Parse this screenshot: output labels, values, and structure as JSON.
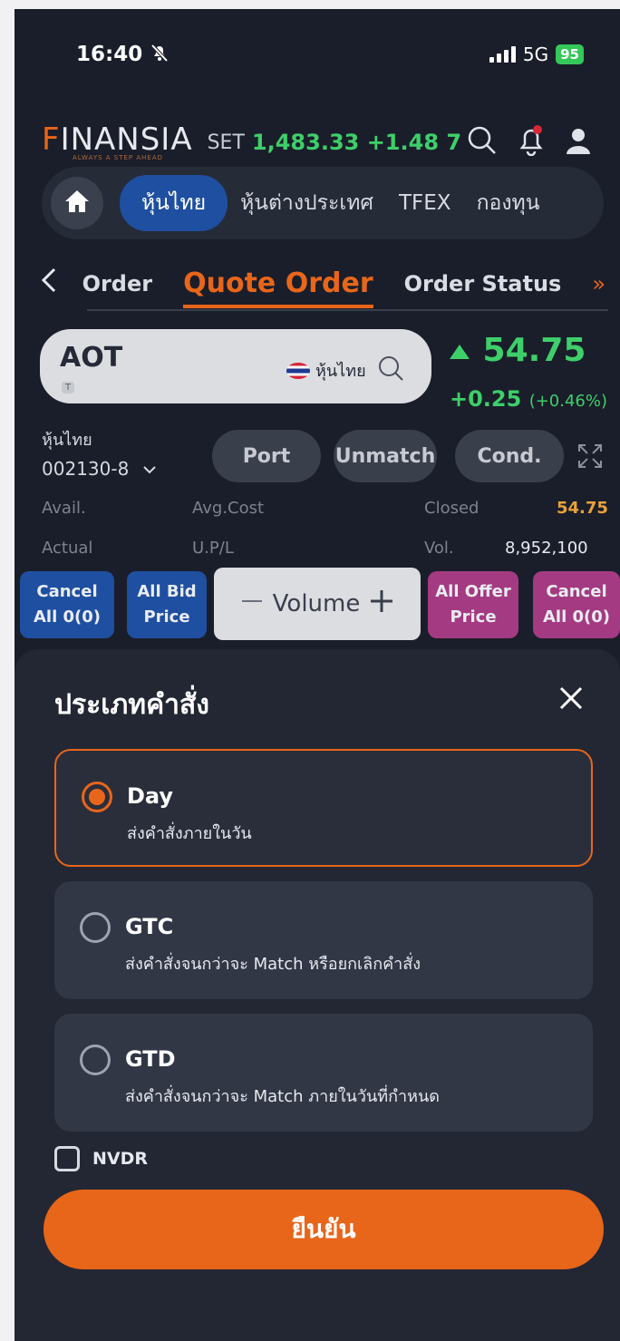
{
  "status_bar": {
    "time": "16:40",
    "network": "5G",
    "battery": "95"
  },
  "header": {
    "logo": "FINANSIA",
    "logo_tagline": "ALWAYS A STEP AHEAD",
    "index_label": "SET",
    "index_value": "1,483.33 +1.48 7",
    "icons": [
      "search-icon",
      "bell-icon",
      "user-icon"
    ]
  },
  "nav": {
    "tabs": [
      {
        "label": "หุ้นไทย",
        "active": true
      },
      {
        "label": "หุ้นต่างประเทศ",
        "active": false
      },
      {
        "label": "TFEX",
        "active": false
      },
      {
        "label": "กองทุน",
        "active": false
      }
    ]
  },
  "sub_tabs": {
    "items": [
      {
        "label": "Order",
        "active": false
      },
      {
        "label": "Quote Order",
        "active": true
      },
      {
        "label": "Order Status",
        "active": false
      }
    ],
    "more": "»"
  },
  "symbol": {
    "ticker": "AOT",
    "badge": "T",
    "market": "หุ้นไทย",
    "price": "54.75",
    "change": "+0.25",
    "change_pct": "(+0.46%)"
  },
  "account": {
    "type": "หุ้นไทย",
    "number": "002130-8",
    "buttons": [
      "Port",
      "Unmatch",
      "Cond."
    ]
  },
  "info": {
    "avail_label": "Avail.",
    "avg_cost_label": "Avg.Cost",
    "closed_label": "Closed",
    "closed_value": "54.75",
    "actual_label": "Actual",
    "upl_label": "U.P/L",
    "vol_label": "Vol.",
    "vol_value": "8,952,100"
  },
  "quote_actions": {
    "cancel_bid": [
      "Cancel",
      "All 0(0)"
    ],
    "all_bid": [
      "All Bid",
      "Price"
    ],
    "volume": "Volume",
    "all_offer": [
      "All Offer",
      "Price"
    ],
    "cancel_offer": [
      "Cancel",
      "All 0(0)"
    ]
  },
  "sheet": {
    "title": "ประเภทคำสั่ง",
    "options": [
      {
        "name": "Day",
        "desc": "ส่งคำสั่งภายในวัน",
        "selected": true
      },
      {
        "name": "GTC",
        "desc": "ส่งคำสั่งจนกว่าจะ Match หรือยกเลิกคำสั่ง",
        "selected": false
      },
      {
        "name": "GTD",
        "desc": "ส่งคำสั่งจนกว่าจะ Match ภายในวันที่กำหนด",
        "selected": false
      }
    ],
    "nvdr_label": "NVDR",
    "confirm_label": "ยืนยัน"
  },
  "colors": {
    "accent": "#e8661a",
    "up": "#3ecf6a",
    "bg": "#1a1e2a",
    "blue": "#1f4fa0",
    "pink": "#a43a82"
  }
}
